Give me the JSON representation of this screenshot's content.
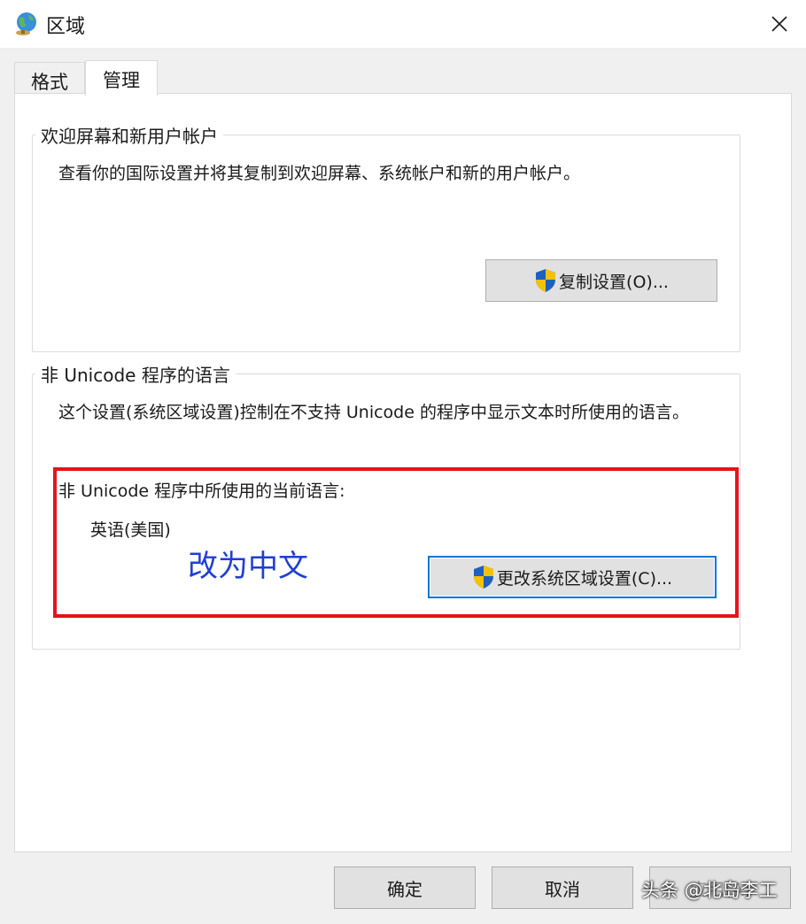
{
  "window": {
    "title": "区域",
    "icon": "globe-icon",
    "close_icon": "close-icon"
  },
  "tabs": [
    {
      "label": "格式",
      "active": false
    },
    {
      "label": "管理",
      "active": true
    }
  ],
  "welcome_group": {
    "title": "欢迎屏幕和新用户帐户",
    "description": "查看你的国际设置并将其复制到欢迎屏幕、系统帐户和新的用户帐户。",
    "copy_button": "复制设置(O)..."
  },
  "unicode_group": {
    "title": "非 Unicode 程序的语言",
    "description": "这个设置(系统区域设置)控制在不支持 Unicode 的程序中显示文本时所使用的语言。",
    "current_label": "非 Unicode 程序中所使用的当前语言:",
    "current_value": "英语(美国)",
    "change_button": "更改系统区域设置(C)..."
  },
  "annotation": {
    "text": "改为中文",
    "color": "#1f3fd6",
    "highlight_color": "#e3141b"
  },
  "footer": {
    "ok": "确定",
    "cancel": "取消",
    "apply": "应用(A)"
  },
  "watermark": "头条 @北岛李工"
}
